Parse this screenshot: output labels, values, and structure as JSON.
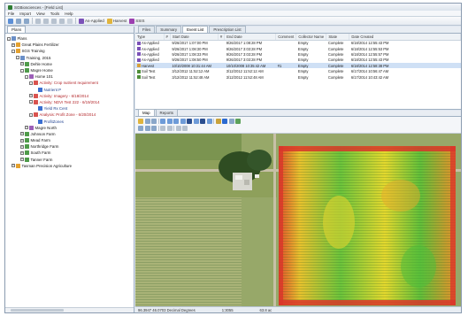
{
  "window": {
    "title": "SGBiosciences - [Field List]"
  },
  "menu": [
    "File",
    "Import",
    "View",
    "Tools",
    "Help"
  ],
  "toolbar": {
    "as_applied": "As-Applied",
    "harvest": "Harvest",
    "ssurgo": "SSIS"
  },
  "left_panel": {
    "tab": "Plans",
    "tree": [
      {
        "label": "Plans",
        "level": 0,
        "exp": "-",
        "icon": "root"
      },
      {
        "label": "Great Plains Fertilizer",
        "level": 1,
        "exp": "+",
        "icon": "grower"
      },
      {
        "label": "SGS Training",
        "level": 1,
        "exp": "-",
        "icon": "grower"
      },
      {
        "label": "Training, 2015",
        "level": 2,
        "exp": "-",
        "icon": "root"
      },
      {
        "label": "Dehle Home",
        "level": 3,
        "exp": "+",
        "icon": "farm"
      },
      {
        "label": "Magre Home",
        "level": 3,
        "exp": "-",
        "icon": "farm"
      },
      {
        "label": "Home 101",
        "level": 4,
        "exp": "-",
        "icon": "field"
      },
      {
        "label": "Activity: Crop nutrient requirement",
        "level": 5,
        "exp": "-",
        "icon": "activity",
        "cls": "red"
      },
      {
        "label": "Nutrient P",
        "level": 6,
        "exp": "",
        "icon": "image",
        "cls": "blue"
      },
      {
        "label": "Activity: Imagery - 6/18/2014",
        "level": 5,
        "exp": "+",
        "icon": "activity",
        "cls": "red"
      },
      {
        "label": "Activity: NDVI Test 222 - 6/19/2014",
        "level": 5,
        "exp": "-",
        "icon": "activity",
        "cls": "red"
      },
      {
        "label": "Yield Rx Cent",
        "level": 6,
        "exp": "",
        "icon": "image",
        "cls": "blue"
      },
      {
        "label": "Analysis: Profit Zone - 6/20/2014",
        "level": 5,
        "exp": "-",
        "icon": "activity",
        "cls": "red"
      },
      {
        "label": "ProfitZones",
        "level": 6,
        "exp": "",
        "icon": "image",
        "cls": "blue"
      },
      {
        "label": "Magre North",
        "level": 4,
        "exp": "+",
        "icon": "field"
      },
      {
        "label": "Johnson Farm",
        "level": 3,
        "exp": "+",
        "icon": "farm"
      },
      {
        "label": "Mead Farm",
        "level": 3,
        "exp": "+",
        "icon": "farm"
      },
      {
        "label": "Northridge Farm",
        "level": 3,
        "exp": "+",
        "icon": "farm"
      },
      {
        "label": "South Farm",
        "level": 3,
        "exp": "+",
        "icon": "farm"
      },
      {
        "label": "Tanner Farm",
        "level": 3,
        "exp": "+",
        "icon": "farm"
      },
      {
        "label": "Tasman Precision Agriculture",
        "level": 1,
        "exp": "+",
        "icon": "grower"
      }
    ]
  },
  "event_panel": {
    "tabs": [
      "Files",
      "Summary",
      "Event List",
      "Prescription List"
    ],
    "active_tab": "Event List",
    "columns": [
      "Type",
      "#",
      "Start Date",
      "#",
      "End Date",
      "Comment",
      "Collector Name",
      "State",
      "Date Created"
    ],
    "rows": [
      {
        "type": "As-Applied",
        "color": "#7b52b8",
        "start": "9/26/2017 1:07:00 PM",
        "end": "9/26/2017 1:08:28 PM",
        "comment": "",
        "collector": "Empty",
        "state": "Complete",
        "created": "6/18/2014 12:55:43 PM"
      },
      {
        "type": "As-Applied",
        "color": "#7b52b8",
        "start": "9/26/2017 1:08:30 PM",
        "end": "9/26/2017 3:03:28 PM",
        "comment": "",
        "collector": "Empty",
        "state": "Complete",
        "created": "6/18/2014 12:55:53 PM"
      },
      {
        "type": "As-Applied",
        "color": "#7b52b8",
        "start": "9/26/2017 1:08:33 PM",
        "end": "9/26/2017 3:03:28 PM",
        "comment": "",
        "collector": "Empty",
        "state": "Complete",
        "created": "6/18/2014 12:55:57 PM"
      },
      {
        "type": "As-Applied",
        "color": "#7b52b8",
        "start": "9/26/2017 1:08:50 PM",
        "end": "9/26/2017 3:03:28 PM",
        "comment": "",
        "collector": "Empty",
        "state": "Complete",
        "created": "6/18/2014 12:55:43 PM"
      },
      {
        "type": "Harvest",
        "color": "#d9a23a",
        "start": "10/10/2008 10:31:44 AM",
        "end": "10/10/2008 10:35:42 AM",
        "comment": "#1",
        "collector": "Empty",
        "state": "Complete",
        "created": "6/18/2014 12:58:38 PM"
      },
      {
        "type": "Soil Test",
        "color": "#4f8f3a",
        "start": "3/12/2012 11:52:12 AM",
        "end": "3/12/2012 11:52:12 AM",
        "comment": "",
        "collector": "Empty",
        "state": "Complete",
        "created": "6/17/2014 10:56:47 AM"
      },
      {
        "type": "Soil Test",
        "color": "#4f8f3a",
        "start": "3/12/2012 11:52:48 AM",
        "end": "3/12/2012 11:52:48 AM",
        "comment": "",
        "collector": "Empty",
        "state": "Complete",
        "created": "6/17/2014 10:43:42 AM"
      }
    ]
  },
  "map_panel": {
    "tabs": [
      "Map",
      "Reports"
    ],
    "active_tab": "Map",
    "status": {
      "coords": "96.3947 46.0703 Decimal Degrees",
      "scale": "1:3055",
      "zoom": "63.8 ac"
    }
  },
  "colors": {
    "yield_high": "#3fbf3f",
    "yield_mid": "#e6e62e",
    "yield_low": "#e03a2a",
    "accent": "#2e7d32"
  }
}
